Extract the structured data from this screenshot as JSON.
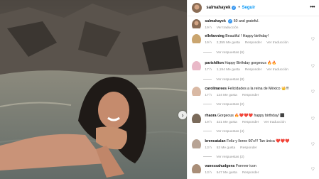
{
  "header": {
    "username": "salmahayek",
    "separator": "•",
    "follow_label": "Seguir"
  },
  "caption": {
    "username": "salmahayek",
    "text": "60 and grateful.",
    "time": "19 h",
    "translate": "Ver traducción"
  },
  "comments": [
    {
      "username": "ellefanning",
      "text": "Beautiful ! Happy birthday!",
      "time": "19 h",
      "likes": "2,355 Me gusta",
      "reply": "Responder",
      "translate": "Ver traducción",
      "replies": "Ver respuestas (6)",
      "avatar_color": "#caa56f"
    },
    {
      "username": "parishilton",
      "text": "Happy Birthday gorgeous 🔥🔥",
      "time": "17 h",
      "likes": "1,194 Me gusta",
      "reply": "Responder",
      "translate": "Ver traducción",
      "replies": "Ver respuestas (8)",
      "avatar_color": "#e9b9c8"
    },
    {
      "username": "carolinarees",
      "text": "Felicidades a la reina de México 👑!!!",
      "time": "17 h",
      "likes": "124 Me gusta",
      "reply": "Responder",
      "translate": "",
      "replies": "Ver respuestas (2)",
      "avatar_color": "#d9b9a4"
    },
    {
      "username": "rhaora",
      "text": "Gorgeous 🔥❤️❤️❤️ happy birthday! ⬛",
      "time": "19 h",
      "likes": "321 Me gusta",
      "reply": "Responder",
      "translate": "Ver traducción",
      "replies": "Ver respuestas (4)",
      "avatar_color": "#7a6a5a"
    },
    {
      "username": "brencatalan",
      "text": "Feliz y lloree 60's!!! Tan única ❤️❤️❤️",
      "time": "13 h",
      "likes": "53 Me gusta",
      "reply": "Responder",
      "translate": "",
      "replies": "Ver respuestas (2)",
      "avatar_color": "#b7a394"
    },
    {
      "username": "vanessahudgens",
      "text": "Forever icon",
      "time": "13 h",
      "likes": "547 Me gusta",
      "reply": "Responder",
      "translate": "",
      "replies": "",
      "avatar_color": "#a98e78"
    }
  ],
  "colors": {
    "accent": "#0095f6",
    "verified": "#3897f0"
  }
}
